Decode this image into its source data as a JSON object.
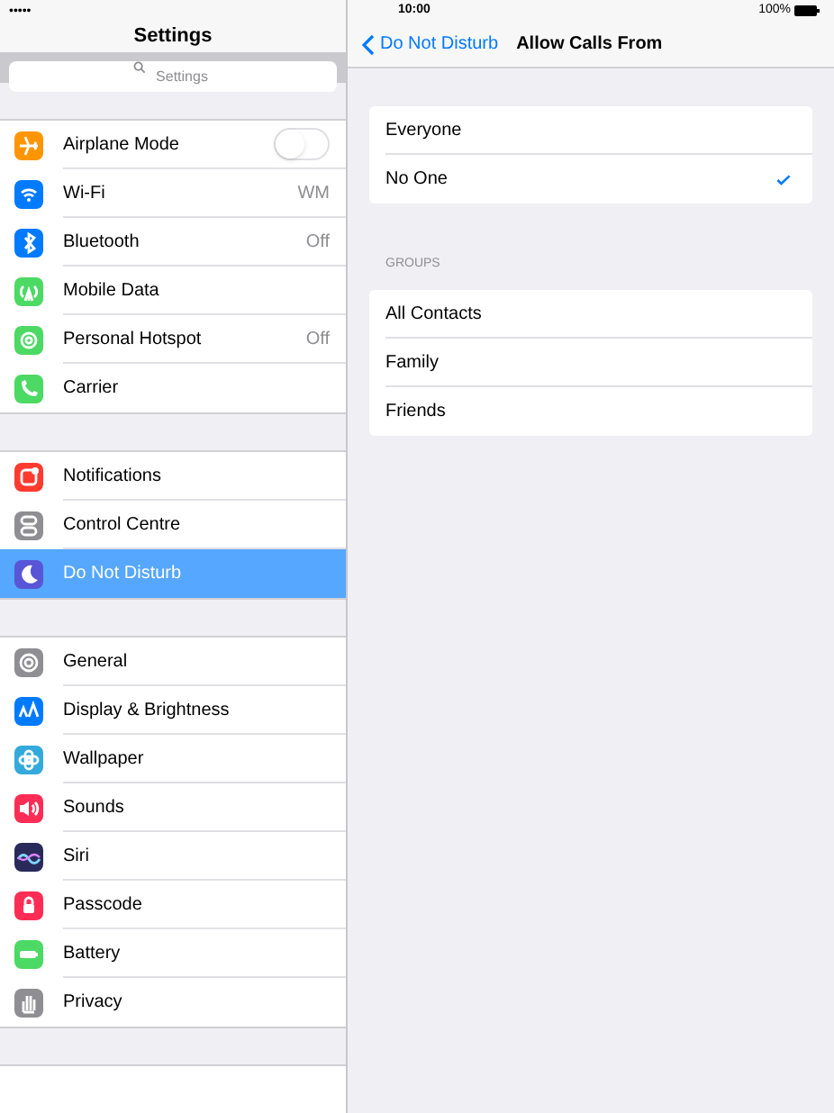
{
  "status_bar": {
    "signal": "•••••",
    "time": "10:00",
    "battery": "100%"
  },
  "sidebar": {
    "title": "Settings",
    "search": {
      "placeholder": "Settings"
    },
    "groups": [
      {
        "items": [
          {
            "label": "Airplane Mode",
            "kind": "toggle",
            "on": false,
            "color": "#ff9500",
            "selected": false
          },
          {
            "label": "Wi-Fi",
            "kind": "detail",
            "detail": "WM",
            "color": "#007aff",
            "selected": false
          },
          {
            "label": "Bluetooth",
            "kind": "detail",
            "detail": "Off",
            "color": "#007aff",
            "selected": false
          },
          {
            "label": "Mobile Data",
            "kind": "plain",
            "color": "#4cd964",
            "selected": false
          },
          {
            "label": "Personal Hotspot",
            "kind": "detail",
            "detail": "Off",
            "color": "#4cd964",
            "selected": false
          },
          {
            "label": "Carrier",
            "kind": "plain",
            "color": "#4cd964",
            "selected": false
          }
        ]
      },
      {
        "items": [
          {
            "label": "Notifications",
            "kind": "plain",
            "color": "#ff3b30",
            "selected": false
          },
          {
            "label": "Control Centre",
            "kind": "plain",
            "color": "#8e8e93",
            "selected": false
          },
          {
            "label": "Do Not Disturb",
            "kind": "plain",
            "color": "#5856d6",
            "selected": true
          }
        ]
      },
      {
        "items": [
          {
            "label": "General",
            "kind": "plain",
            "color": "#8e8e93",
            "selected": false
          },
          {
            "label": "Display & Brightness",
            "kind": "plain",
            "color": "#007aff",
            "selected": false
          },
          {
            "label": "Wallpaper",
            "kind": "plain",
            "color": "#34aadc",
            "selected": false
          },
          {
            "label": "Sounds",
            "kind": "plain",
            "color": "#ff2d55",
            "selected": false
          },
          {
            "label": "Siri",
            "kind": "plain",
            "color": "#2a2a5a",
            "selected": false
          },
          {
            "label": "Passcode",
            "kind": "plain",
            "color": "#ff2d55",
            "selected": false
          },
          {
            "label": "Battery",
            "kind": "plain",
            "color": "#4cd964",
            "selected": false
          },
          {
            "label": "Privacy",
            "kind": "plain",
            "color": "#8e8e93",
            "selected": false
          }
        ]
      }
    ]
  },
  "detail": {
    "back": "Do Not Disturb",
    "title": "Allow Calls From",
    "options": [
      {
        "label": "Everyone",
        "selected": false
      },
      {
        "label": "No One",
        "selected": true
      }
    ],
    "groups_header": "GROUPS",
    "groups": [
      {
        "label": "All Contacts"
      },
      {
        "label": "Family"
      },
      {
        "label": "Friends"
      }
    ]
  }
}
